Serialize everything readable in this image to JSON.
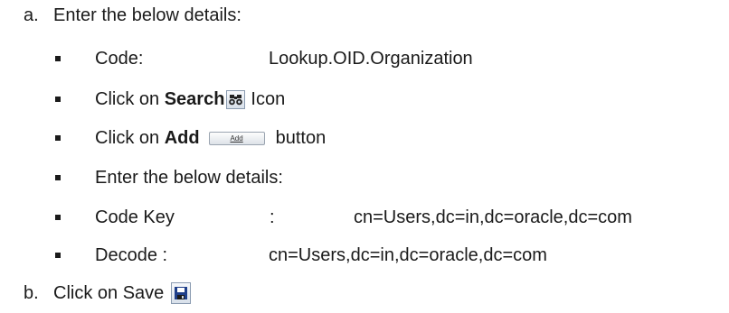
{
  "items": {
    "a_marker": "a.",
    "a_text": "Enter the below details:",
    "code_label": "Code:",
    "code_value": "Lookup.OID.Organization",
    "search_prefix": "Click on ",
    "search_bold": "Search",
    "search_suffix": "Icon",
    "add_prefix": "Click on ",
    "add_bold": "Add",
    "add_button_label": "Add",
    "add_suffix": "button",
    "enter_text": "Enter the below details:",
    "codekey_label": "Code Key",
    "codekey_colon": ":",
    "codekey_value": "cn=Users,dc=in,dc=oracle,dc=com",
    "decode_label": "Decode :",
    "decode_value": "cn=Users,dc=in,dc=oracle,dc=com",
    "b_marker": "b.",
    "b_text": "Click on Save"
  },
  "icons": {
    "search": "binoculars-icon",
    "save": "floppy-disk-icon"
  }
}
